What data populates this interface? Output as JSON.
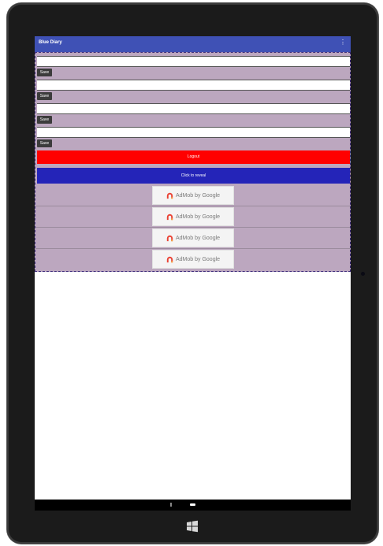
{
  "appbar": {
    "title": "Blue Diary",
    "menu_glyph": "⋮"
  },
  "entries": [
    {
      "field_value": "",
      "save_label": "Save"
    },
    {
      "field_value": "",
      "save_label": "Save"
    },
    {
      "field_value": "",
      "save_label": "Save"
    },
    {
      "field_value": "",
      "save_label": "Save"
    }
  ],
  "buttons": {
    "logout_label": "Logout",
    "reveal_label": "Click to reveal"
  },
  "ads": [
    {
      "label": "AdMob by Google"
    },
    {
      "label": "AdMob by Google"
    },
    {
      "label": "AdMob by Google"
    },
    {
      "label": "AdMob by Google"
    }
  ],
  "colors": {
    "appbar": "#3f51b5",
    "content_bg": "#bca7bf",
    "logout": "#ff0000",
    "reveal": "#2424b8",
    "admob_red": "#ea4335",
    "admob_orange": "#f4a23b"
  },
  "icons": {
    "device_home": "windows-logo-icon",
    "admob": "admob-logo-icon"
  }
}
